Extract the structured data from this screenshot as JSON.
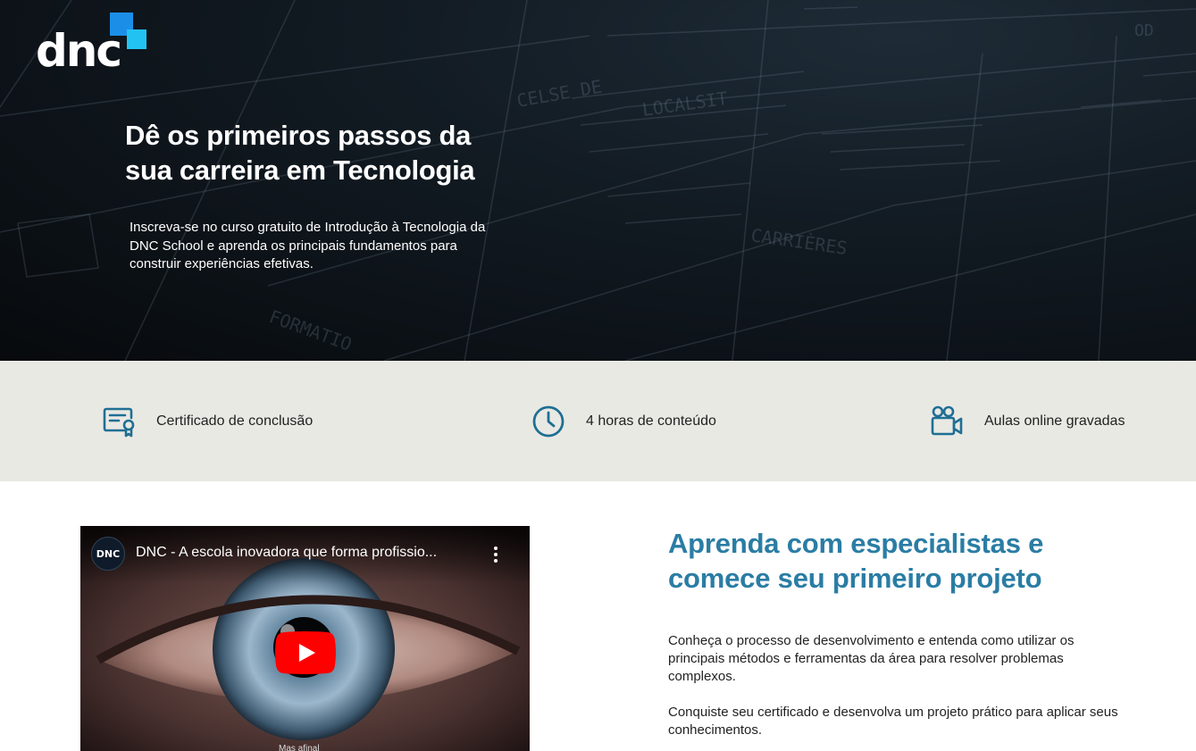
{
  "brand": {
    "logo_text": "dnc"
  },
  "hero": {
    "title_line1": "Dê os primeiros passos da",
    "title_line2": "sua carreira em Tecnologia",
    "description": "Inscreva-se no curso gratuito de Introdução à Tecnologia da DNC School e aprenda os principais fundamentos para construir experiências efetivas."
  },
  "features": [
    {
      "icon": "certificate-icon",
      "label": "Certificado de conclusão"
    },
    {
      "icon": "clock-icon",
      "label": "4 horas de conteúdo"
    },
    {
      "icon": "video-camera-icon",
      "label": "Aulas online gravadas"
    }
  ],
  "video": {
    "channel_badge": "DNC",
    "title": "DNC - A escola inovadora que forma profissio...",
    "caption": "Mas afinal"
  },
  "section": {
    "title_line1": "Aprenda com especialistas e",
    "title_line2": "comece seu primeiro projeto",
    "paragraph1": "Conheça o processo de desenvolvimento e entenda como utilizar os principais métodos e ferramentas da área para resolver problemas complexos.",
    "paragraph2": "Conquiste seu certificado e desenvolva um projeto prático para aplicar seus conhecimentos."
  },
  "colors": {
    "accent": "#2a7da4",
    "icon": "#1f6f94",
    "features_bg": "#e9e9e4",
    "logo_blue": "#1b8fe8",
    "logo_cyan": "#22c3f3",
    "youtube_red": "#ff0000"
  }
}
